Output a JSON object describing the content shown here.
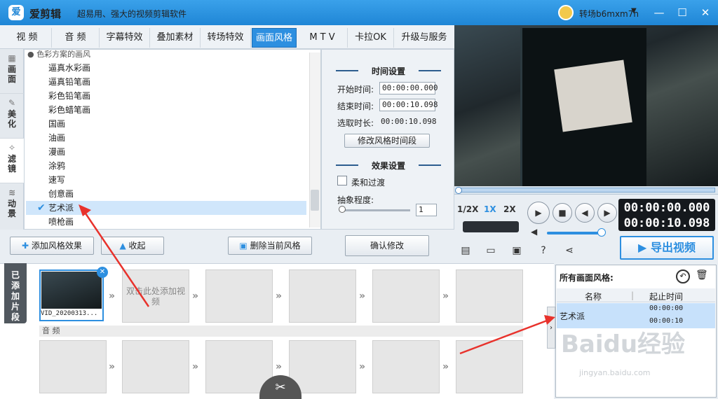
{
  "app": {
    "logo": "爱",
    "name": "爱剪辑",
    "slogan": "超易用、强大的视频剪辑软件",
    "username": "转场b6mxm7n",
    "user_dropdown": "▼",
    "minimize": "—",
    "maximize": "☐",
    "close": "✕"
  },
  "tabs": [
    "视 频",
    "音 频",
    "字幕特效",
    "叠加素材",
    "转场特效",
    "画面风格",
    "M T V",
    "卡拉OK",
    "升级与服务"
  ],
  "active_tab": "画面风格",
  "side_tabs": [
    {
      "icon": "▦",
      "label": "画面"
    },
    {
      "icon": "✎",
      "label": "美化"
    },
    {
      "icon": "✧",
      "label": "滤镜"
    },
    {
      "icon": "≋",
      "label": "动景"
    }
  ],
  "filter_list": {
    "header": "● 色彩方案的画风",
    "items": [
      "逼真水彩画",
      "逼真铅笔画",
      "彩色铅笔画",
      "彩色蜡笔画",
      "国画",
      "油画",
      "漫画",
      "涂鸦",
      "速写",
      "创意画",
      "艺术派",
      "喷枪画"
    ],
    "selected": "艺术派",
    "check": "✔"
  },
  "settings": {
    "time_heading": "时间设置",
    "start_label": "开始时间:",
    "start_value": "00:00:00.000",
    "end_label": "结束时间:",
    "end_value": "00:00:10.098",
    "duration_label": "选取时长:",
    "duration_value": "00:00:10.098",
    "modify_time_button": "修改风格时间段",
    "effect_heading": "效果设置",
    "smooth_label": "柔和过渡",
    "abstract_label": "抽象程度:",
    "abstract_value": "1",
    "confirm_button": "确认修改"
  },
  "actions": {
    "add_style": "添加风格效果",
    "collapse": "收起",
    "delete_style": "删除当前风格"
  },
  "player": {
    "speed_half": "1/2X",
    "speed_1x": "1X",
    "speed_2x": "2X",
    "play": "▶",
    "stop": "■",
    "prev": "◀",
    "next": "▶",
    "current_time": "00:00:00.000",
    "total_time": "00:00:10.098",
    "volume_icon": "◀",
    "volume": 0.9,
    "progress": 0.0,
    "export_button": "导出视频",
    "export_icon": "▶",
    "tools": [
      "▤",
      "▭",
      "▣",
      "?",
      "⋖"
    ]
  },
  "timeline": {
    "added_tab": "已添加片段",
    "clip_name": "VID_20200313...",
    "placeholder": "双击此处添加视频",
    "audio_label": "音 频",
    "remove_clip": "✕",
    "arrow": "»",
    "scissors": "✂",
    "collapse": "›"
  },
  "styles_panel": {
    "title": "所有画面风格:",
    "undo": "↶",
    "trash": "🗑",
    "col_name": "名称",
    "col_time": "起止时间",
    "row_name": "艺术派",
    "row_start": "00:00:00",
    "row_end": "00:00:10"
  },
  "watermark": {
    "logo": "Baidu经验",
    "url": "jingyan.baidu.com"
  },
  "colors": {
    "accent": "#2d8fe0",
    "annotation": "#e8322c"
  }
}
